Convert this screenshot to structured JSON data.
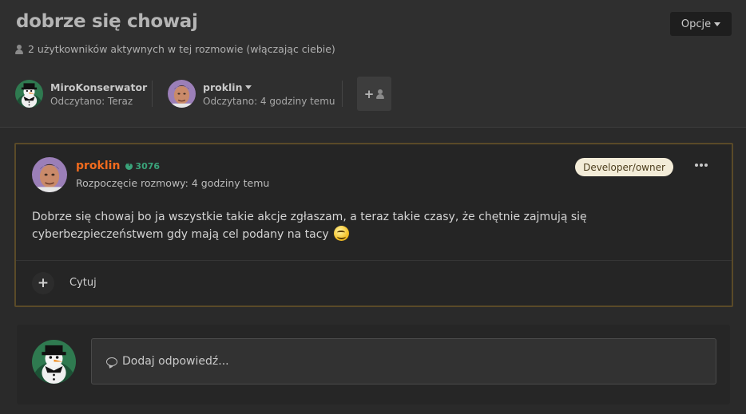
{
  "header": {
    "title": "dobrze się chowaj",
    "options_label": "Opcje",
    "active_users": "2 użytkowników aktywnych w tej rozmowie (włączając ciebie)"
  },
  "participants": [
    {
      "name": "MiroKonserwator",
      "read": "Odczytano: Teraz"
    },
    {
      "name": "proklin",
      "read": "Odczytano: 4 godziny temu"
    }
  ],
  "post": {
    "author": "proklin",
    "reputation": "3076",
    "started": "Rozpoczęcie rozmowy: 4 godziny temu",
    "badge": "Developer/owner",
    "content": "Dobrze się chowaj bo ja wszystkie takie akcje zgłaszam, a teraz takie czasy, że chętnie zajmują się cyberbezpieczeństwem gdy mają cel podany na tacy",
    "quote_label": "Cytuj"
  },
  "reply": {
    "placeholder": "Dodaj odpowiedź..."
  },
  "colors": {
    "author_accent": "#f26b1d",
    "reputation_green": "#3aa37a",
    "post_border": "#5a4a28",
    "badge_bg": "#f3ecd8"
  }
}
